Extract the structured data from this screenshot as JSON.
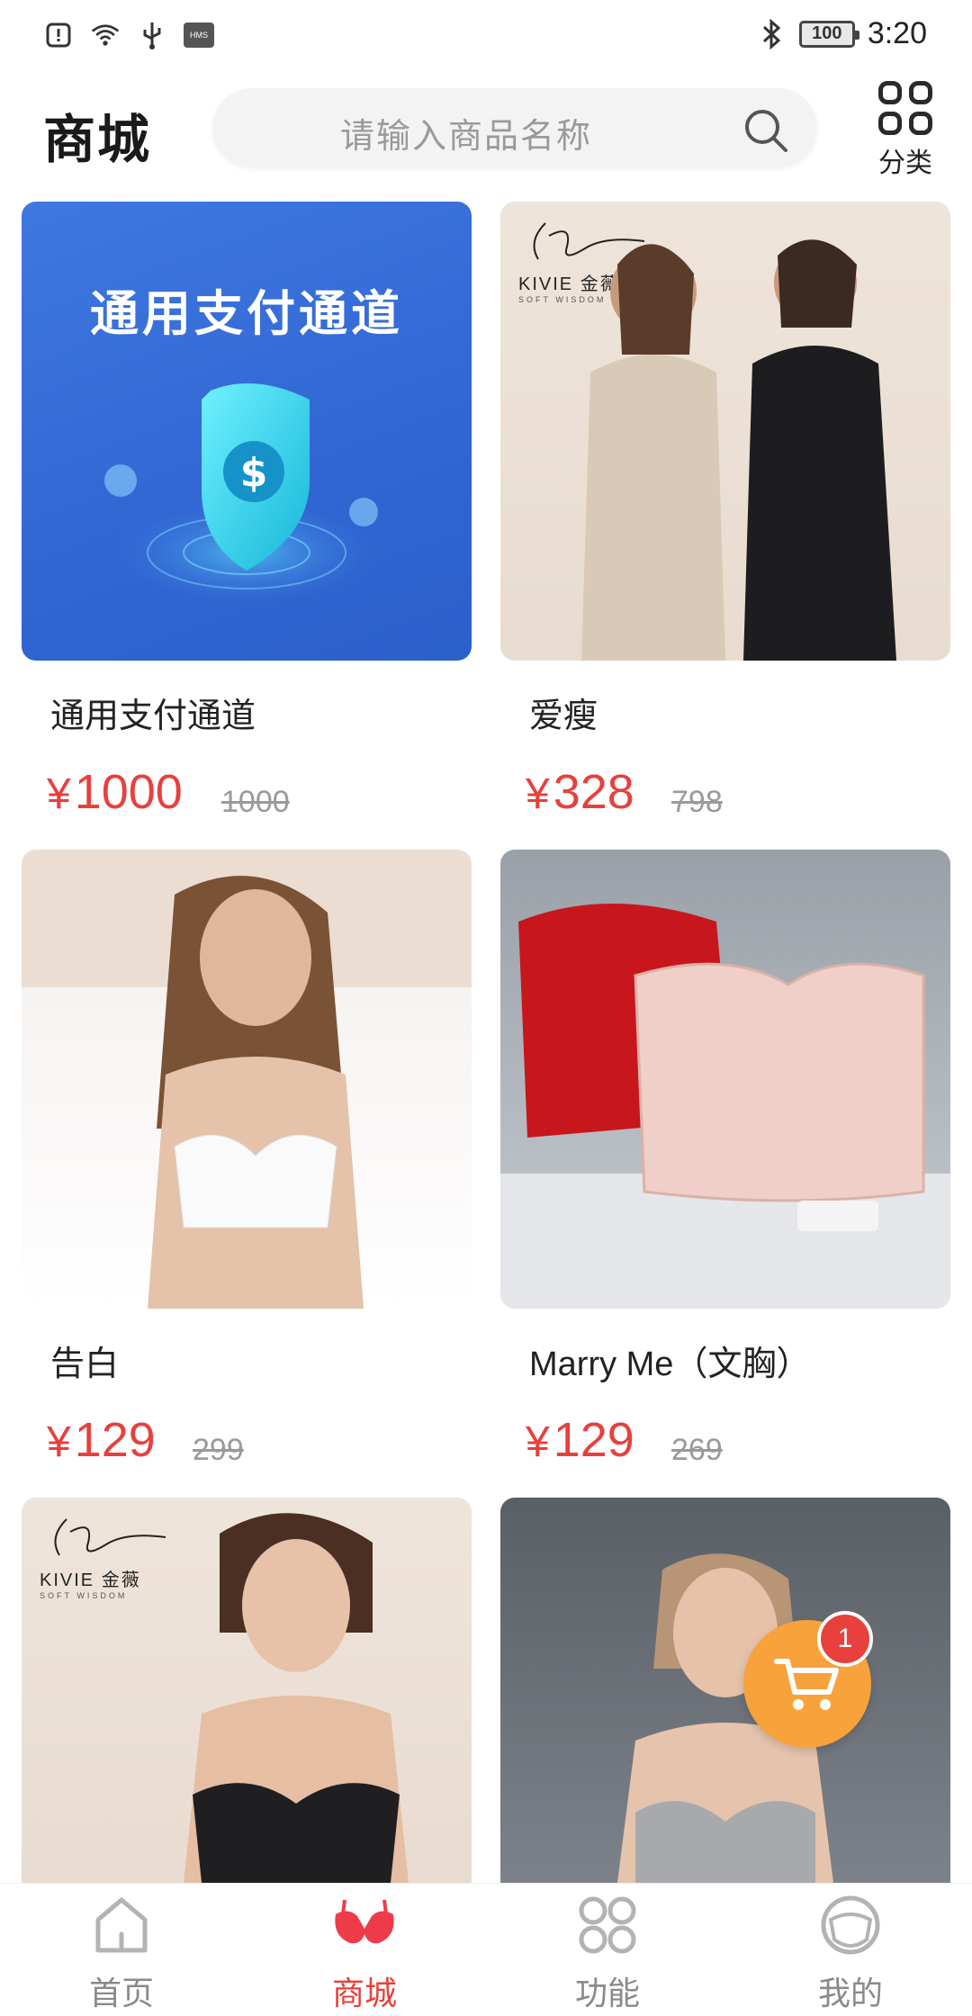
{
  "status_bar": {
    "time": "3:20",
    "battery": "100",
    "left_icons": [
      "alert-icon",
      "wifi-icon",
      "usb-icon",
      "hms-icon"
    ],
    "right_icons": [
      "bluetooth-icon",
      "battery-icon"
    ]
  },
  "header": {
    "title": "商城",
    "search_placeholder": "请输入商品名称",
    "category_label": "分类"
  },
  "products": [
    {
      "name": "通用支付通道",
      "price": "1000",
      "original_price": "1000",
      "currency": "¥",
      "image_text": "通用支付通道"
    },
    {
      "name": "爱瘦",
      "price": "328",
      "original_price": "798",
      "currency": "¥",
      "brand": "KIVIE 金薇",
      "brand_sub": "SOFT WISDOM"
    },
    {
      "name": "告白",
      "price": "129",
      "original_price": "299",
      "currency": "¥"
    },
    {
      "name": "Marry Me（文胸）",
      "price": "129",
      "original_price": "269",
      "currency": "¥"
    },
    {
      "brand": "KIVIE 金薇",
      "brand_sub": "SOFT WISDOM"
    },
    {}
  ],
  "cart": {
    "count": "1"
  },
  "bottom_nav": {
    "items": [
      {
        "label": "首页"
      },
      {
        "label": "商城"
      },
      {
        "label": "功能"
      },
      {
        "label": "我的"
      }
    ]
  },
  "colors": {
    "accent": "#e8403d",
    "cart": "#f7a23b",
    "payment_bg": "#3f78e0"
  }
}
